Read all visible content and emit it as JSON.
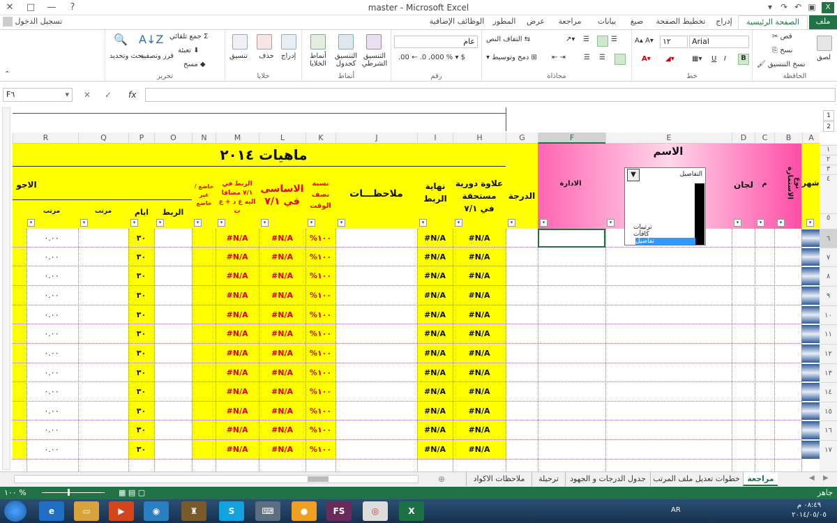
{
  "window": {
    "title": "master - Microsoft Excel",
    "signin": "تسجيل الدخول",
    "controls": [
      "?",
      "□",
      "—",
      "✕"
    ]
  },
  "tabs": [
    "ملف",
    "الصفحة الرئيسية",
    "إدراج",
    "تخطيط الصفحة",
    "صيغ",
    "بيانات",
    "مراجعة",
    "عرض",
    "المطور",
    "الوظائف الإضافية"
  ],
  "ribbon": {
    "clipboard": {
      "label": "الحافظة",
      "paste": "لصق",
      "cut": "قص",
      "copy": "نسخ",
      "format_painter": "نسخ التنسيق"
    },
    "font": {
      "label": "خط",
      "name": "Arial",
      "size": "١٢",
      "bold": "B",
      "italic": "I",
      "underline": "U"
    },
    "alignment": {
      "label": "محاذاة",
      "wrap": "التفاف النص",
      "merge": "دمج وتوسيط"
    },
    "number": {
      "label": "رقم",
      "format": "عام"
    },
    "styles": {
      "label": "أنماط",
      "cond": "التنسيق الشرطي",
      "table": "التنسيق كجدول",
      "cell": "أنماط الخلايا"
    },
    "cells": {
      "label": "خلايا",
      "insert": "إدراج",
      "delete": "حذف",
      "format": "تنسيق"
    },
    "editing": {
      "label": "تحرير",
      "autosum": "جمع تلقائي",
      "fill": "تعبئة",
      "clear": "مسح",
      "sort": "فرز وتصفية",
      "find": "بحث وتحديد"
    }
  },
  "formula_bar": {
    "namebox": "F٦",
    "value": ""
  },
  "outline_levels": [
    "1",
    "2"
  ],
  "columns": [
    "A",
    "B",
    "C",
    "D",
    "E",
    "F",
    "G",
    "H",
    "I",
    "J",
    "K",
    "L",
    "M",
    "N",
    "O",
    "P",
    "Q",
    "R"
  ],
  "rows": [
    "١",
    "٢",
    "٣",
    "٤",
    "٥",
    "٦",
    "٧",
    "٨",
    "٩",
    "١٠",
    "١١",
    "١٢",
    "١٣",
    "١٤",
    "١٥",
    "١٦",
    "١٧"
  ],
  "sheet": {
    "title": "ماهيات ٢٠١٤",
    "h_name": "الاسم",
    "h_admin": "الادارة",
    "h_month": "شهر",
    "h_type": "نوع الاستمارة",
    "h_m": "م",
    "h_committees": "لجان",
    "h_grade": "الدرجة",
    "h_bonus": "علاوة دورية مستحقة في ٧/١",
    "h_end": "نهاية الربط",
    "h_notes": "ملاحظـــات",
    "h_half": "نسبة نصف الوقت",
    "h_basic": "الاساسى في ٧/١",
    "h_link": "الربط في ٧/١ مضافا اليه ع د + ع ت",
    "h_subject": "خاضع / غير خاضع",
    "h_wages": "الاجو",
    "h_rabt": "الربط",
    "h_days": "ايام",
    "h_salary": "مرتب",
    "h_salary2": "مرتب",
    "v_na": "#N/A",
    "v_pct": "%١٠٠",
    "v_days": "٣٠",
    "v_salary": "٠.٠٠"
  },
  "dropdown": {
    "selected": "التفاصيل",
    "options": [
      "ترتيبات",
      "كافآت",
      "تفاصيل"
    ]
  },
  "sheet_tabs": [
    "مراجعة",
    "خطوات تعديل ملف المرتب",
    "جدول الدرجات و الجهود",
    "ترحيلة",
    "ملاحظات الاكواد"
  ],
  "status": {
    "ready": "جاهز",
    "zoom": "١٠٠ %"
  },
  "taskbar": {
    "lang": "AR",
    "time": "٠٨:٤٩ م",
    "date": "٢٠١٤/٠٥/٠٥"
  }
}
